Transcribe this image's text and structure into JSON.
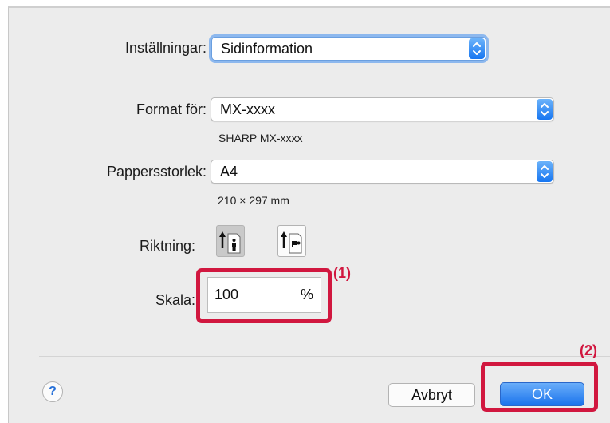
{
  "settings": {
    "label": "Inställningar:",
    "value": "Sidinformation"
  },
  "format_for": {
    "label": "Format för:",
    "value": "MX-xxxx",
    "printer_name": "SHARP MX-xxxx"
  },
  "paper_size": {
    "label": "Pappersstorlek:",
    "value": "A4",
    "dimensions": "210  ×  297 mm"
  },
  "orientation": {
    "label": "Riktning:",
    "selected": "portrait"
  },
  "scale": {
    "label": "Skala:",
    "value": "100",
    "unit": "%"
  },
  "callouts": {
    "scale_marker": "(1)",
    "ok_marker": "(2)"
  },
  "buttons": {
    "help": "?",
    "cancel": "Avbryt",
    "ok": "OK"
  },
  "colors": {
    "accent_blue": "#1a73ec",
    "callout_red": "#d1173f",
    "dialog_bg": "#ececec"
  }
}
